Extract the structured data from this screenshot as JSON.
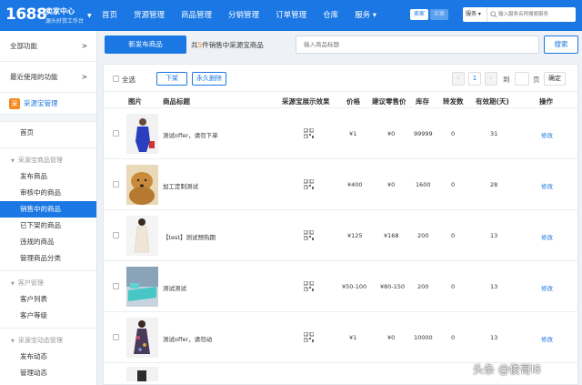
{
  "header": {
    "logo_number": "1688",
    "logo_title": "卖家中心",
    "logo_subtitle": "源头好货工作台",
    "nav": [
      "首页",
      "货源管理",
      "商品管理",
      "分销管理",
      "订单管理",
      "仓库",
      "服务 ▾"
    ],
    "seller_badge": "卖家",
    "buyer_badge": "买家",
    "search_scope": "服务 ▾",
    "search_placeholder": "输入服务名称搜索服务"
  },
  "sidebar": {
    "all_functions": "全部功能",
    "recent": "最近使用的功能",
    "arrow": ">",
    "app_icon": "采",
    "app_name": "采源宝管理",
    "home": "首页",
    "group1": "采源宝商品管理",
    "group1_items": [
      "发布商品",
      "审核中的商品",
      "销售中的商品",
      "已下架的商品",
      "违规的商品",
      "管理商品分类"
    ],
    "group2": "客户管理",
    "group2_items": [
      "客户列表",
      "客户等级"
    ],
    "group3": "采源宝动态管理",
    "group3_items": [
      "发布动态",
      "管理动态"
    ]
  },
  "toolbar": {
    "publish_label": "新发布商品",
    "count_prefix": "共",
    "count": "5",
    "count_suffix": "件销售中采源宝商品",
    "search_placeholder": "输入商品标题",
    "search_label": "搜索"
  },
  "actions": {
    "select_all": "全选",
    "offline": "下架",
    "delete": "永久删除",
    "prev": "‹",
    "current_page": "1",
    "next": "›",
    "goto": "到",
    "page": "页",
    "confirm": "确定"
  },
  "table": {
    "headers": [
      "图片",
      "商品标题",
      "采源宝展示效果",
      "价格",
      "建议零售价",
      "库存",
      "转发数",
      "有效期(天)",
      "操作"
    ],
    "rows": [
      {
        "title": "测试offer，请勿下单",
        "price": "¥1",
        "retail": "¥0",
        "stock": "99999",
        "forwards": "0",
        "validity": "31",
        "op": "修改"
      },
      {
        "title": "加工定制测试",
        "price": "¥400",
        "retail": "¥0",
        "stock": "1600",
        "forwards": "0",
        "validity": "28",
        "op": "修改"
      },
      {
        "title": "【test】测试预热期",
        "price": "¥125",
        "retail": "¥168",
        "stock": "200",
        "forwards": "0",
        "validity": "13",
        "op": "修改"
      },
      {
        "title": "测试测试",
        "price": "¥50-100",
        "retail": "¥80-150",
        "stock": "200",
        "forwards": "0",
        "validity": "13",
        "op": "修改"
      },
      {
        "title": "测试offer，请勿动",
        "price": "¥1",
        "retail": "¥0",
        "stock": "10000",
        "forwards": "0",
        "validity": "13",
        "op": "修改"
      }
    ]
  },
  "watermark": "头条 @俊哥l8",
  "colors": {
    "primary": "#1a77e3",
    "accent": "#f58a1f"
  }
}
